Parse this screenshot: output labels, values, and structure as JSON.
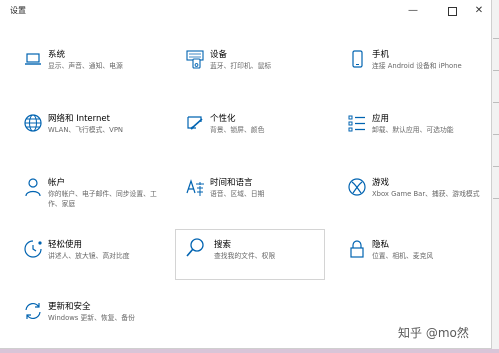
{
  "window": {
    "title": "设置"
  },
  "controls": {
    "minimize": "—",
    "maximize": "",
    "close": "✕"
  },
  "tiles": [
    {
      "name": "系统",
      "desc": "显示、声音、通知、电源",
      "icon": "laptop-icon"
    },
    {
      "name": "设备",
      "desc": "蓝牙、打印机、鼠标",
      "icon": "devices-icon"
    },
    {
      "name": "手机",
      "desc": "连接 Android 设备和 iPhone",
      "icon": "phone-icon"
    },
    {
      "name": "网络和 Internet",
      "desc": "WLAN、飞行模式、VPN",
      "icon": "globe-icon"
    },
    {
      "name": "个性化",
      "desc": "背景、锁屏、颜色",
      "icon": "paintbrush-icon"
    },
    {
      "name": "应用",
      "desc": "卸载、默认应用、可选功能",
      "icon": "apps-list-icon"
    },
    {
      "name": "帐户",
      "desc": "你的帐户、电子邮件、同步设置、工作、家庭",
      "icon": "person-icon"
    },
    {
      "name": "时间和语言",
      "desc": "语音、区域、日期",
      "icon": "time-language-icon"
    },
    {
      "name": "游戏",
      "desc": "Xbox Game Bar、捕获、游戏模式",
      "icon": "xbox-icon"
    },
    {
      "name": "轻松使用",
      "desc": "讲述人、放大镜、高对比度",
      "icon": "ease-of-access-icon"
    },
    {
      "name": "搜索",
      "desc": "查找我的文件、权限",
      "icon": "search-icon"
    },
    {
      "name": "隐私",
      "desc": "位置、相机、麦克风",
      "icon": "lock-icon"
    },
    {
      "name": "更新和安全",
      "desc": "Windows 更新、恢复、备份",
      "icon": "update-icon"
    }
  ],
  "watermark": "知乎 @mo然",
  "colors": {
    "accent": "#0063b1"
  }
}
